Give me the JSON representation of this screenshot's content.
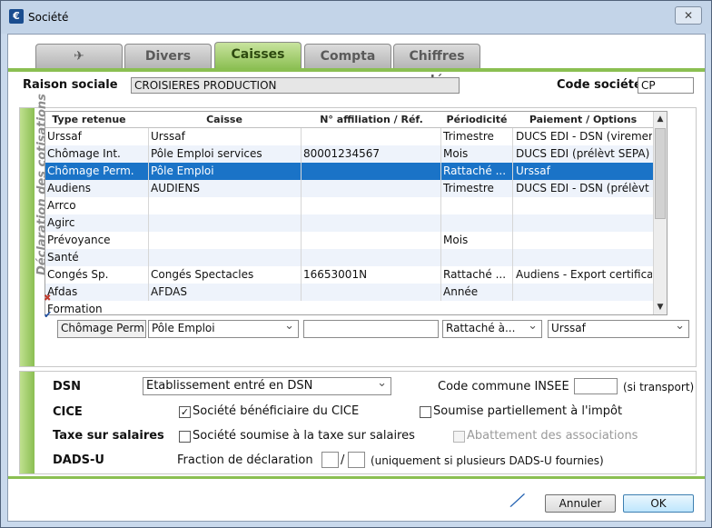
{
  "window": {
    "title": "Société",
    "app_icon": "app-icon",
    "close": "✕"
  },
  "tabs": [
    {
      "label": "✈"
    },
    {
      "label": "Divers"
    },
    {
      "label": "Caisses",
      "active": true
    },
    {
      "label": "Compta"
    },
    {
      "label": "Chiffres clés"
    }
  ],
  "header": {
    "raison_sociale_label": "Raison sociale",
    "raison_sociale_value": "CROISIERES PRODUCTION",
    "code_societe_label": "Code société",
    "code_societe_value": "CP"
  },
  "cotisations": {
    "section_title": "Déclaration des cotisations",
    "columns": [
      "Type retenue",
      "Caisse",
      "N° affiliation / Réf.",
      "Périodicité",
      "Paiement / Options"
    ],
    "rows": [
      [
        "Urssaf",
        "Urssaf",
        "",
        "Trimestre",
        "DUCS EDI - DSN (virement)"
      ],
      [
        "Chômage Int.",
        "Pôle Emploi services",
        "80001234567",
        "Mois",
        "DUCS EDI (prélèvt SEPA) - ..."
      ],
      [
        "Chômage Perm.",
        "Pôle Emploi",
        "",
        "Rattaché ...",
        "Urssaf"
      ],
      [
        "Audiens",
        "AUDIENS",
        "",
        "Trimestre",
        "DUCS EDI - DSN (prélèvt SE..."
      ],
      [
        "Arrco",
        "",
        "",
        "",
        ""
      ],
      [
        "Agirc",
        "",
        "",
        "",
        ""
      ],
      [
        "Prévoyance",
        "",
        "",
        "Mois",
        ""
      ],
      [
        "Santé",
        "",
        "",
        "",
        ""
      ],
      [
        "Congés Sp.",
        "Congés Spectacles",
        "16653001N",
        "Rattaché ...",
        "Audiens - Export certificats CS"
      ],
      [
        "Afdas",
        "AFDAS",
        "",
        "Année",
        ""
      ],
      [
        "Formation",
        "",
        "",
        "",
        ""
      ]
    ],
    "selected_row": 2,
    "row_marks": {
      "afdas": "✖",
      "formation": "✔"
    },
    "editor": {
      "type": "Chômage Perm",
      "caisse": "Pôle Emploi",
      "affiliation": "",
      "periodicite": "Rattaché à...",
      "paiement": "Urssaf"
    }
  },
  "options": {
    "dsn_label": "DSN",
    "dsn_value": "Etablissement entré en DSN",
    "code_commune_label": "Code commune INSEE",
    "code_commune_value": "",
    "code_commune_note": "(si transport)",
    "cice_label": "CICE",
    "cice_beneficiaire": "Société bénéficiaire du CICE",
    "cice_beneficiaire_checked": true,
    "cice_partiel": "Soumise partiellement à l'impôt",
    "taxe_label": "Taxe sur salaires",
    "taxe_soumise": "Société soumise à la taxe sur salaires",
    "abattement": "Abattement des associations",
    "dadsu_label": "DADS-U",
    "fraction_label": "Fraction de déclaration",
    "fraction_sep": "/",
    "fraction_note": "(uniquement si plusieurs DADS-U fournies)"
  },
  "footer": {
    "edit_icon": "pencil-icon",
    "cancel": "Annuler",
    "ok": "OK"
  }
}
